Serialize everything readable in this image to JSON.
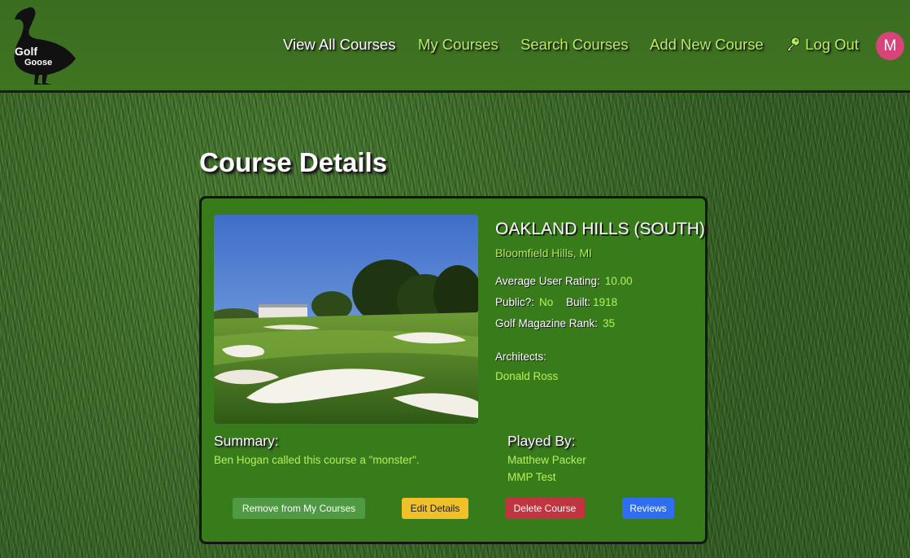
{
  "header": {
    "logo_text": "Golf Goose",
    "nav": {
      "view_all": "View All Courses",
      "my_courses": "My Courses",
      "search": "Search Courses",
      "add_new": "Add New Course",
      "logout": "Log Out"
    },
    "avatar_initial": "M"
  },
  "page": {
    "title": "Course Details"
  },
  "course": {
    "name": "OAKLAND HILLS (SOUTH)",
    "location": "Bloomfield Hills, MI",
    "avg_rating_label": "Average User Rating:",
    "avg_rating": "10.00",
    "public_label": "Public?:",
    "public": "No",
    "built_label": "Built:",
    "built": "1918",
    "rank_label": "Golf Magazine Rank:",
    "rank": "35",
    "architects_label": "Architects:",
    "architects": [
      "Donald Ross"
    ],
    "summary_label": "Summary:",
    "summary": "Ben Hogan called this course a \"monster\".",
    "played_by_label": "Played By:",
    "played_by": [
      "Matthew Packer",
      "MMP Test"
    ]
  },
  "actions": {
    "remove": "Remove from My Courses",
    "edit": "Edit Details",
    "delete": "Delete Course",
    "reviews": "Reviews"
  },
  "colors": {
    "accent_green": "#b7f05a",
    "btn_remove": "#4f9a43",
    "btn_edit": "#f0c02b",
    "btn_delete": "#c0353f",
    "btn_reviews": "#2f6ef2",
    "avatar": "#d6447a"
  },
  "icons": {
    "logout": "key-icon",
    "logo": "goose-logo"
  }
}
